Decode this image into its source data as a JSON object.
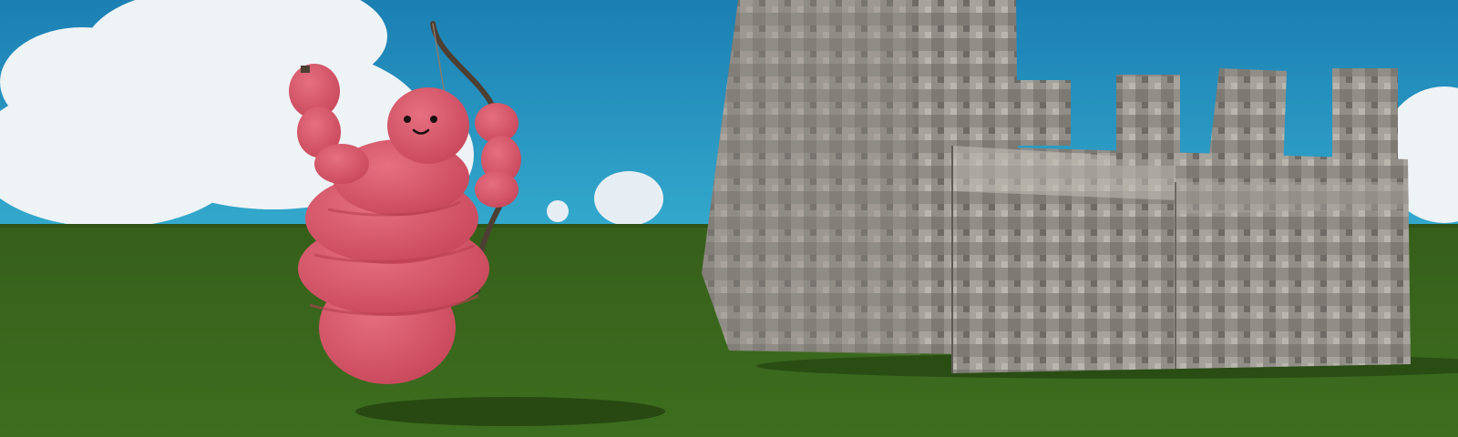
{
  "scene": {
    "type": "3d-game-viewport",
    "colors": {
      "sky_top": "#1f86b8",
      "sky_bottom": "#2ea6c9",
      "cloud": "#eef3f6",
      "grass": "#3a6a1c",
      "grass_dark": "#2f5a16",
      "character": "#d9566a",
      "character_shadow": "#b8404f",
      "stone": "#8f8c86",
      "stone_light": "#b3b0a9",
      "stone_dark": "#6b6863",
      "bow": "#5a4a3c"
    },
    "objects": {
      "character": "pink-blob-character",
      "weapon": "bow",
      "structure": "stone-castle-wall"
    }
  }
}
